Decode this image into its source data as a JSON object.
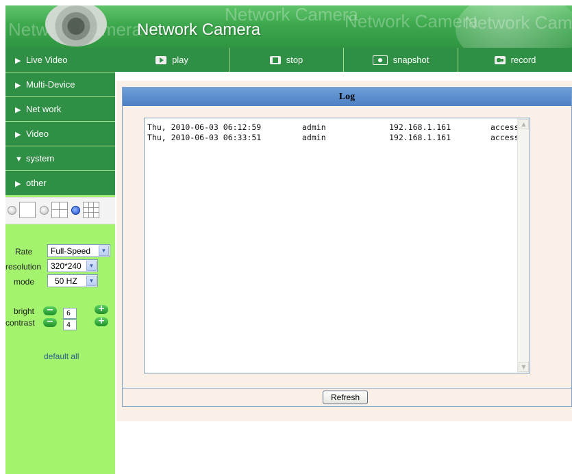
{
  "header": {
    "title": "Network Camera",
    "watermark": "Network Camera"
  },
  "sidebar": {
    "items": [
      {
        "label": "Live Video",
        "icon": "triangle-right-icon"
      },
      {
        "label": "Multi-Device",
        "icon": "triangle-right-icon"
      },
      {
        "label": "Net work",
        "icon": "triangle-right-icon"
      },
      {
        "label": "Video",
        "icon": "triangle-right-icon"
      },
      {
        "label": "system",
        "icon": "triangle-down-icon"
      },
      {
        "label": "other",
        "icon": "triangle-right-icon"
      }
    ],
    "controls": {
      "rate_label": "Rate",
      "rate_value": "Full-Speed",
      "resolution_label": "resolution",
      "resolution_value": "320*240",
      "mode_label": "mode",
      "mode_value": "50 HZ",
      "bright_label": "bright",
      "bright_value": "6",
      "contrast_label": "contrast",
      "contrast_value": "4",
      "default_all": "default all"
    }
  },
  "toolbar": {
    "play": "play",
    "stop": "stop",
    "snapshot": "snapshot",
    "record": "record"
  },
  "log": {
    "title": "Log",
    "rows": [
      {
        "date": "Thu, 2010-06-03 06:12:59",
        "user": "admin",
        "ip": "192.168.1.161",
        "action": "access"
      },
      {
        "date": "Thu, 2010-06-03 06:33:51",
        "user": "admin",
        "ip": "192.168.1.161",
        "action": "access"
      }
    ],
    "refresh": "Refresh"
  },
  "colors": {
    "nav_green": "#2f8f45",
    "sidebar_bg": "#a3f36e",
    "panel_bg": "#faf0e8",
    "log_header": "#5a8ccc"
  }
}
